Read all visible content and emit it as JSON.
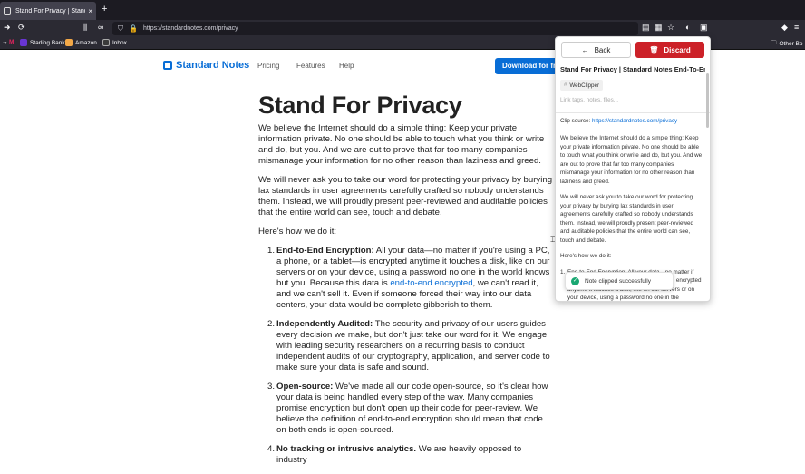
{
  "browser": {
    "tab_title": "Stand For Privacy | Standard No",
    "tab_close": "×",
    "new_tab": "+",
    "url": "https://standardnotes.com/privacy",
    "bookmarks": [
      "Starling Bank",
      "Amazon",
      "Inbox"
    ],
    "other_bookmarks": "Other Bo"
  },
  "site": {
    "logo": "Standard Notes",
    "nav": [
      "Pricing",
      "Features",
      "Help"
    ],
    "download": "Download for fr"
  },
  "article": {
    "title": "Stand For Privacy",
    "p1": "We believe the Internet should do a simple thing: Keep your private information private. No one should be able to touch what you think or write and do, but you. And we are out to prove that far too many companies mismanage your information for no other reason than laziness and greed.",
    "p2": "We will never ask you to take our word for protecting your privacy by burying lax standards in user agreements carefully crafted so nobody understands them. Instead, we will proudly present peer-reviewed and auditable policies that the entire world can see, touch and debate.",
    "p3": "Here's how we do it:",
    "items": [
      {
        "num": "1.",
        "head": "End-to-End Encryption:",
        "pre": " All your data—no matter if you're using a PC, a phone, or a tablet—is encrypted anytime it touches a disk, like on our servers or on your device, using a password no one in the world knows but you. Because this data is ",
        "link": "end-to-end encrypted",
        "post": ", we can't read it, and we can't sell it. Even if someone forced their way into our data centers, your data would be complete gibberish to them."
      },
      {
        "num": "2.",
        "head": "Independently Audited:",
        "pre": " The security and privacy of our users guides every decision we make, but don't just take our word for it. We engage with leading security researchers on a recurring basis to conduct independent audits of our cryptography, application, and server code to make sure your data is safe and sound.",
        "link": "",
        "post": ""
      },
      {
        "num": "3.",
        "head": "Open-source:",
        "pre": " We've made all our code open-source, so it's clear how your data is being handled every step of the way. Many companies promise encryption but don't open up their code for peer-review. We believe the definition of end-to-end encryption should mean that code on both ends is open-sourced.",
        "link": "",
        "post": ""
      },
      {
        "num": "4.",
        "head": "No tracking or intrusive analytics.",
        "pre": " We are heavily opposed to industry",
        "link": "",
        "post": ""
      }
    ]
  },
  "clipper": {
    "back": "Back",
    "discard": "Discard",
    "title": "Stand For Privacy | Standard Notes End-To-End",
    "tag": "WebClipper",
    "tag_placeholder": "Link tags, notes, files...",
    "source_label": "Clip source: ",
    "source_url": "https://standardnotes.com/privacy",
    "body1": "We believe the Internet should do a simple thing: Keep your private information private. No one should be able to touch what you think or write and do, but you. And we are out to prove that far too many companies mismanage your information for no other reason than laziness and greed.",
    "body2": "We will never ask you to take our word for protecting your privacy by burying lax standards in user agreements carefully crafted so nobody understands them. Instead, we will proudly present peer-reviewed and auditable policies that the entire world can see, touch and debate.",
    "body3": "Here's how we do it:",
    "li_num": "1.",
    "li_text": "End-to-End Encryption: All your data—no matter if you're using a PC, a phone, or a tablet—is encrypted anytime it touches a disk, like on our servers or on your device, using a password no one in the",
    "toast": "Note clipped successfully"
  },
  "colors": {
    "brand": "#086dd6",
    "discard": "#cc2128",
    "success": "#1aa772"
  }
}
